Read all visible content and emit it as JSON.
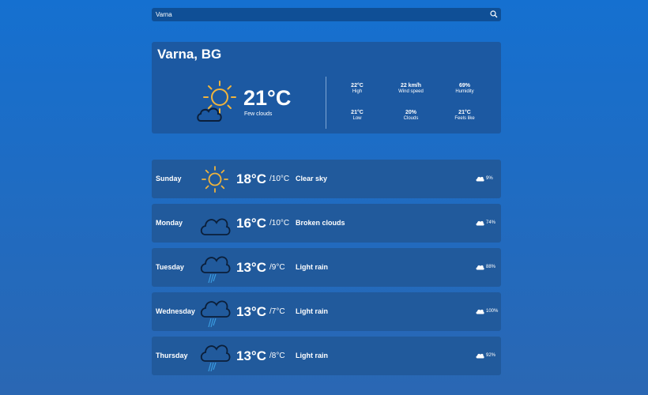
{
  "search": {
    "value": "Varna"
  },
  "current": {
    "city": "Varna, BG",
    "temp": "21°C",
    "description": "Few clouds",
    "icon": "sun-cloud-icon",
    "stats": [
      {
        "value": "22°C",
        "label": "High"
      },
      {
        "value": "22 km/h",
        "label": "Wind speed"
      },
      {
        "value": "69%",
        "label": "Humidity"
      },
      {
        "value": "21°C",
        "label": "Low"
      },
      {
        "value": "20%",
        "label": "Clouds"
      },
      {
        "value": "21°C",
        "label": "Feels like"
      }
    ]
  },
  "forecast": [
    {
      "day": "Sunday",
      "hi": "18°C",
      "lo": "/10°C",
      "desc": "Clear sky",
      "cloud_pct": "9%",
      "icon": "sun-icon"
    },
    {
      "day": "Monday",
      "hi": "16°C",
      "lo": "/10°C",
      "desc": "Broken clouds",
      "cloud_pct": "74%",
      "icon": "cloud-icon"
    },
    {
      "day": "Tuesday",
      "hi": "13°C",
      "lo": "/9°C",
      "desc": "Light rain",
      "cloud_pct": "88%",
      "icon": "rain-icon"
    },
    {
      "day": "Wednesday",
      "hi": "13°C",
      "lo": "/7°C",
      "desc": "Light rain",
      "cloud_pct": "100%",
      "icon": "rain-icon"
    },
    {
      "day": "Thursday",
      "hi": "13°C",
      "lo": "/8°C",
      "desc": "Light rain",
      "cloud_pct": "92%",
      "icon": "rain-icon"
    }
  ],
  "colors": {
    "sun": "#f0b43c",
    "cloud_outline": "#0b1f3a",
    "rain": "#3a9be0"
  }
}
